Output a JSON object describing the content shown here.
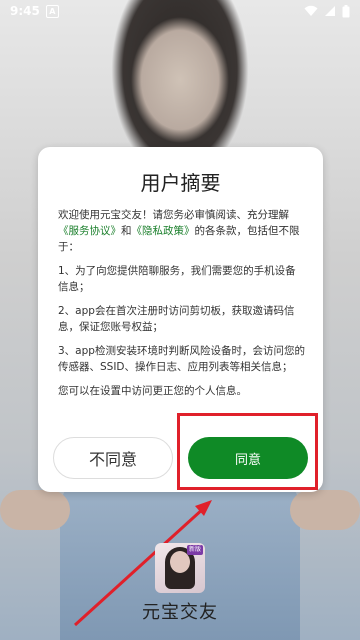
{
  "status_bar": {
    "time": "9:45",
    "notification_badge": "A",
    "icons": [
      "wifi-icon",
      "signal-icon",
      "battery-icon"
    ]
  },
  "dialog": {
    "title": "用户摘要",
    "paragraph1_prefix": "欢迎使用元宝交友！请您务必审慎阅读、充分理解",
    "service_agreement_link": "《服务协议》",
    "and_text": "和",
    "privacy_policy_link": "《隐私政策》",
    "paragraph1_suffix": "的各条款，包括但不限于：",
    "item1": "1、为了向您提供陪聊服务，我们需要您的手机设备信息；",
    "item2": "2、app会在首次注册时访问剪切板，获取邀请码信息，保证您账号权益；",
    "item3": "3、app检测安装环境时判断风险设备时，会访问您的传感器、SSID、操作日志、应用列表等相关信息；",
    "footer_note": "您可以在设置中访问更正您的个人信息。",
    "disagree_button": "不同意",
    "agree_button": "同意"
  },
  "app": {
    "name": "元宝交友",
    "logo_badge": "新版"
  },
  "colors": {
    "accent_green": "#0f8a26",
    "link_green": "#1a7f2b",
    "highlight_red": "#e0202a"
  }
}
